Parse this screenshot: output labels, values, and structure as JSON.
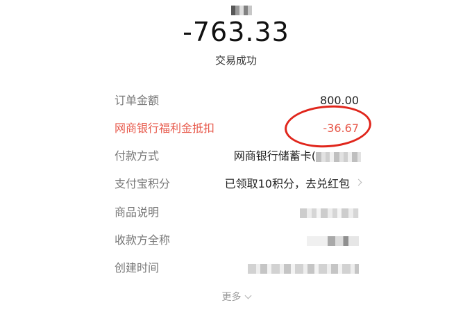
{
  "header": {
    "amount": "-763.33",
    "status": "交易成功"
  },
  "details": {
    "order_amount": {
      "label": "订单金额",
      "value": "800.00"
    },
    "discount": {
      "label": "网商银行福利金抵扣",
      "value": "-36.67"
    },
    "payment_method": {
      "label": "付款方式",
      "value": "网商银行储蓄卡("
    },
    "points": {
      "label": "支付宝积分",
      "value": "已领取10积分，去兑红包"
    },
    "product_desc": {
      "label": "商品说明"
    },
    "payee": {
      "label": "收款方全称"
    },
    "created_time": {
      "label": "创建时间"
    }
  },
  "more": {
    "label": "更多"
  },
  "colors": {
    "discount": "#e7584a",
    "annotation": "#e0261c"
  }
}
